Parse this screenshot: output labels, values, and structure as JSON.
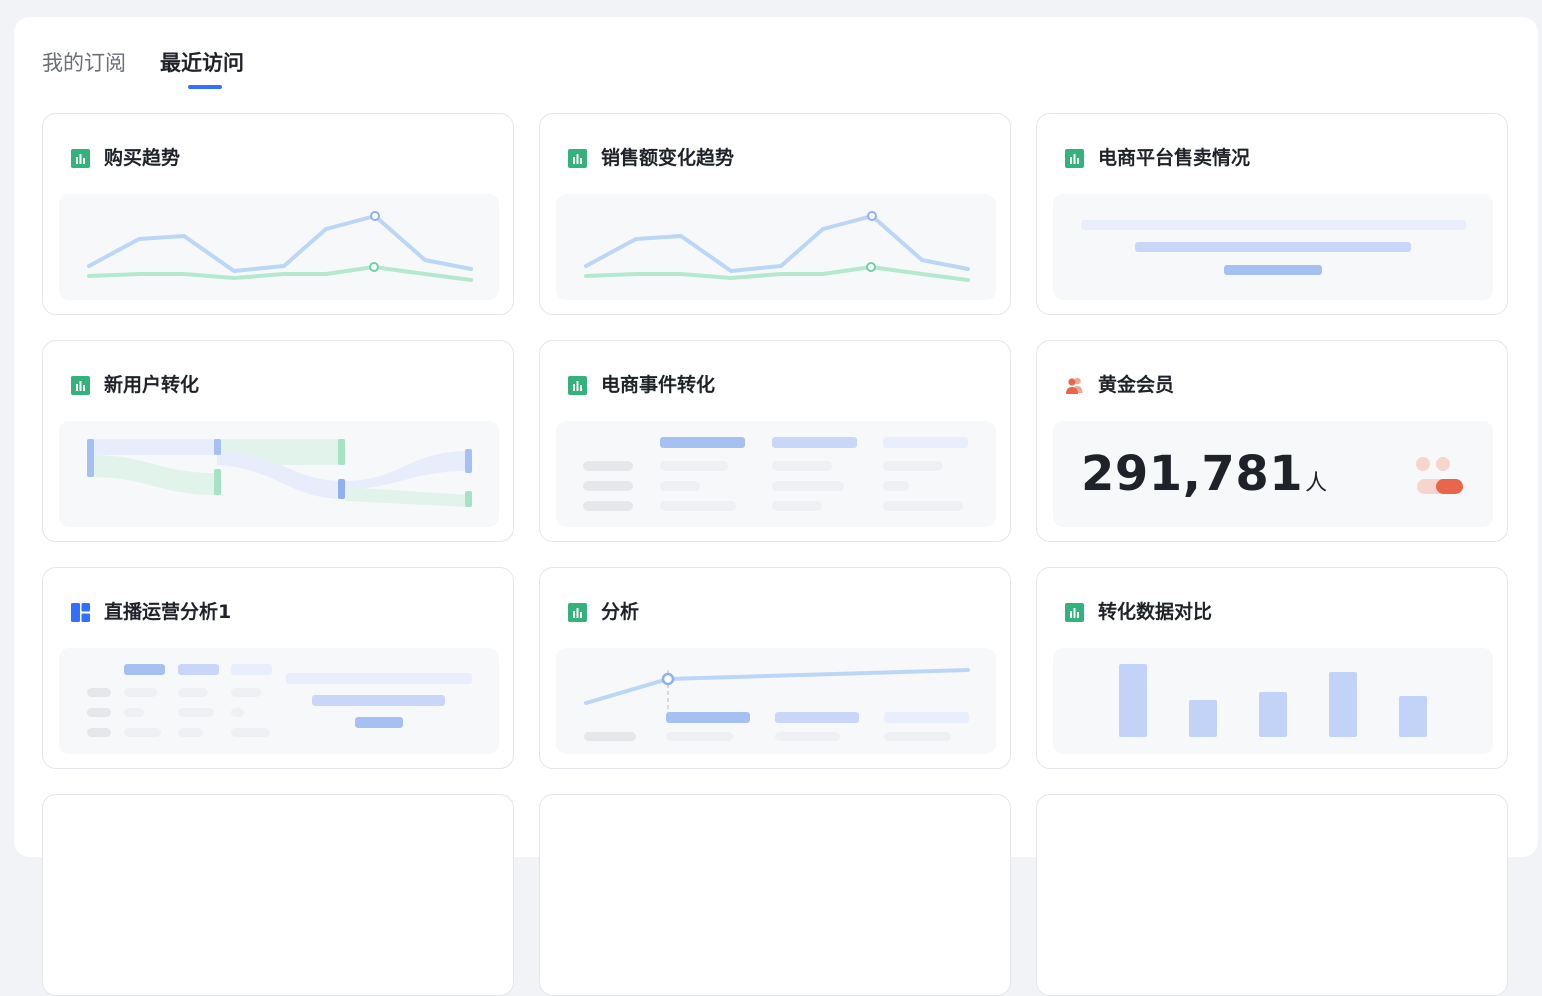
{
  "tabs": [
    {
      "label": "我的订阅",
      "active": false
    },
    {
      "label": "最近访问",
      "active": true
    }
  ],
  "cards": [
    {
      "title": "购买趋势",
      "icon": "bar-chart-icon",
      "preview": "line"
    },
    {
      "title": "销售额变化趋势",
      "icon": "bar-chart-icon",
      "preview": "line"
    },
    {
      "title": "电商平台售卖情况",
      "icon": "bar-chart-icon",
      "preview": "funnel"
    },
    {
      "title": "新用户转化",
      "icon": "bar-chart-icon",
      "preview": "sankey"
    },
    {
      "title": "电商事件转化",
      "icon": "bar-chart-icon",
      "preview": "table"
    },
    {
      "title": "黄金会员",
      "icon": "users-icon",
      "preview": "metric",
      "value": "291,781",
      "unit": "人"
    },
    {
      "title": "直播运营分析1",
      "icon": "dashboard-icon",
      "preview": "dashboard"
    },
    {
      "title": "分析",
      "icon": "bar-chart-icon",
      "preview": "line-table"
    },
    {
      "title": "转化数据对比",
      "icon": "bar-chart-icon",
      "preview": "bars"
    }
  ],
  "colors": {
    "accent": "#3370ff",
    "chart_icon": "#34b27b",
    "users_icon": "#e9654b",
    "dashboard_icon": "#3370ff",
    "line_blue": "#bcd6f8",
    "line_green": "#b4e9cf",
    "bar_blue": "#c3d2f7"
  }
}
